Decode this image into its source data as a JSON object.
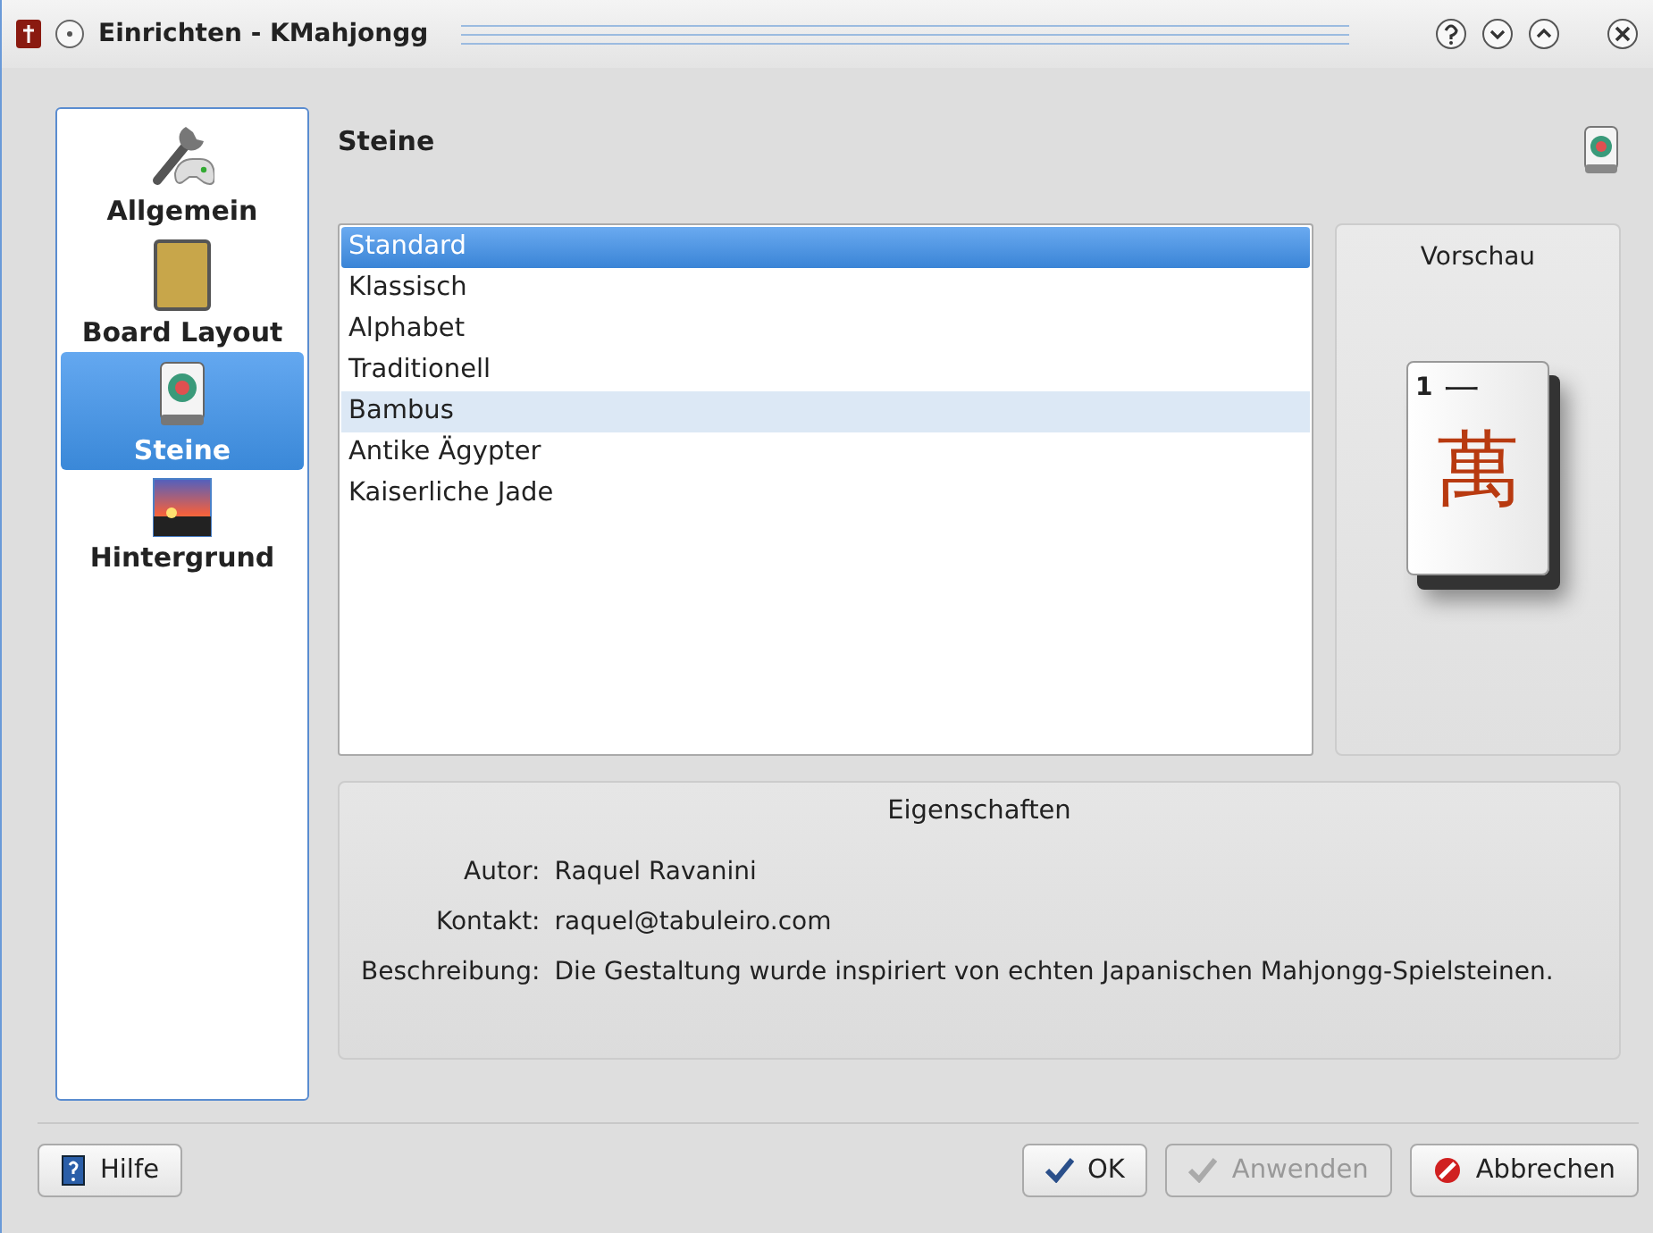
{
  "window": {
    "title": "Einrichten - KMahjongg"
  },
  "sidebar": {
    "items": [
      {
        "label": "Allgemein",
        "kind": "general",
        "selected": false
      },
      {
        "label": "Board Layout",
        "kind": "board",
        "selected": false
      },
      {
        "label": "Steine",
        "kind": "tiles",
        "selected": true
      },
      {
        "label": "Hintergrund",
        "kind": "background",
        "selected": false
      }
    ]
  },
  "page": {
    "title": "Steine"
  },
  "tileset_list": [
    {
      "label": "Standard",
      "selected": true,
      "hovered": false
    },
    {
      "label": "Klassisch",
      "selected": false,
      "hovered": false
    },
    {
      "label": "Alphabet",
      "selected": false,
      "hovered": false
    },
    {
      "label": "Traditionell",
      "selected": false,
      "hovered": false
    },
    {
      "label": "Bambus",
      "selected": false,
      "hovered": true
    },
    {
      "label": "Antike Ägypter",
      "selected": false,
      "hovered": false
    },
    {
      "label": "Kaiserliche Jade",
      "selected": false,
      "hovered": false
    }
  ],
  "preview": {
    "title": "Vorschau",
    "tile_number": "1",
    "tile_numeral": "一",
    "tile_character": "萬"
  },
  "properties": {
    "title": "Eigenschaften",
    "rows": [
      {
        "label": "Autor:",
        "value": "Raquel Ravanini"
      },
      {
        "label": "Kontakt:",
        "value": "raquel@tabuleiro.com"
      },
      {
        "label": "Beschreibung:",
        "value": "Die Gestaltung wurde inspiriert von echten Japanischen Mahjongg-Spielsteinen."
      }
    ]
  },
  "buttons": [
    {
      "label": "Hilfe",
      "kind": "help",
      "disabled": false
    },
    {
      "label": "OK",
      "kind": "ok",
      "disabled": false
    },
    {
      "label": "Anwenden",
      "kind": "apply",
      "disabled": true
    },
    {
      "label": "Abbrechen",
      "kind": "cancel",
      "disabled": false
    }
  ]
}
